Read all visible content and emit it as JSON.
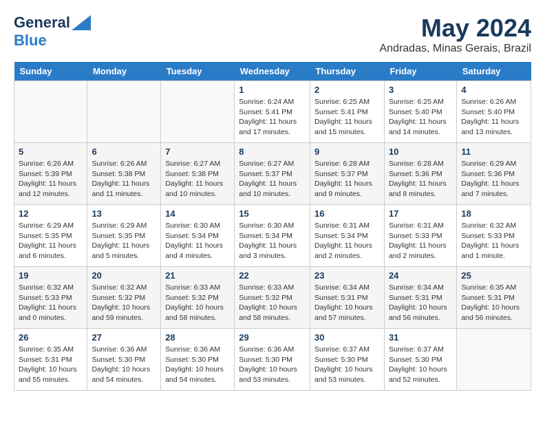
{
  "logo": {
    "line1": "General",
    "line2": "Blue"
  },
  "title": "May 2024",
  "subtitle": "Andradas, Minas Gerais, Brazil",
  "days_of_week": [
    "Sunday",
    "Monday",
    "Tuesday",
    "Wednesday",
    "Thursday",
    "Friday",
    "Saturday"
  ],
  "weeks": [
    [
      {
        "day": "",
        "info": ""
      },
      {
        "day": "",
        "info": ""
      },
      {
        "day": "",
        "info": ""
      },
      {
        "day": "1",
        "info": "Sunrise: 6:24 AM\nSunset: 5:41 PM\nDaylight: 11 hours and 17 minutes."
      },
      {
        "day": "2",
        "info": "Sunrise: 6:25 AM\nSunset: 5:41 PM\nDaylight: 11 hours and 15 minutes."
      },
      {
        "day": "3",
        "info": "Sunrise: 6:25 AM\nSunset: 5:40 PM\nDaylight: 11 hours and 14 minutes."
      },
      {
        "day": "4",
        "info": "Sunrise: 6:26 AM\nSunset: 5:40 PM\nDaylight: 11 hours and 13 minutes."
      }
    ],
    [
      {
        "day": "5",
        "info": "Sunrise: 6:26 AM\nSunset: 5:39 PM\nDaylight: 11 hours and 12 minutes."
      },
      {
        "day": "6",
        "info": "Sunrise: 6:26 AM\nSunset: 5:38 PM\nDaylight: 11 hours and 11 minutes."
      },
      {
        "day": "7",
        "info": "Sunrise: 6:27 AM\nSunset: 5:38 PM\nDaylight: 11 hours and 10 minutes."
      },
      {
        "day": "8",
        "info": "Sunrise: 6:27 AM\nSunset: 5:37 PM\nDaylight: 11 hours and 10 minutes."
      },
      {
        "day": "9",
        "info": "Sunrise: 6:28 AM\nSunset: 5:37 PM\nDaylight: 11 hours and 9 minutes."
      },
      {
        "day": "10",
        "info": "Sunrise: 6:28 AM\nSunset: 5:36 PM\nDaylight: 11 hours and 8 minutes."
      },
      {
        "day": "11",
        "info": "Sunrise: 6:29 AM\nSunset: 5:36 PM\nDaylight: 11 hours and 7 minutes."
      }
    ],
    [
      {
        "day": "12",
        "info": "Sunrise: 6:29 AM\nSunset: 5:35 PM\nDaylight: 11 hours and 6 minutes."
      },
      {
        "day": "13",
        "info": "Sunrise: 6:29 AM\nSunset: 5:35 PM\nDaylight: 11 hours and 5 minutes."
      },
      {
        "day": "14",
        "info": "Sunrise: 6:30 AM\nSunset: 5:34 PM\nDaylight: 11 hours and 4 minutes."
      },
      {
        "day": "15",
        "info": "Sunrise: 6:30 AM\nSunset: 5:34 PM\nDaylight: 11 hours and 3 minutes."
      },
      {
        "day": "16",
        "info": "Sunrise: 6:31 AM\nSunset: 5:34 PM\nDaylight: 11 hours and 2 minutes."
      },
      {
        "day": "17",
        "info": "Sunrise: 6:31 AM\nSunset: 5:33 PM\nDaylight: 11 hours and 2 minutes."
      },
      {
        "day": "18",
        "info": "Sunrise: 6:32 AM\nSunset: 5:33 PM\nDaylight: 11 hours and 1 minute."
      }
    ],
    [
      {
        "day": "19",
        "info": "Sunrise: 6:32 AM\nSunset: 5:33 PM\nDaylight: 11 hours and 0 minutes."
      },
      {
        "day": "20",
        "info": "Sunrise: 6:32 AM\nSunset: 5:32 PM\nDaylight: 10 hours and 59 minutes."
      },
      {
        "day": "21",
        "info": "Sunrise: 6:33 AM\nSunset: 5:32 PM\nDaylight: 10 hours and 58 minutes."
      },
      {
        "day": "22",
        "info": "Sunrise: 6:33 AM\nSunset: 5:32 PM\nDaylight: 10 hours and 58 minutes."
      },
      {
        "day": "23",
        "info": "Sunrise: 6:34 AM\nSunset: 5:31 PM\nDaylight: 10 hours and 57 minutes."
      },
      {
        "day": "24",
        "info": "Sunrise: 6:34 AM\nSunset: 5:31 PM\nDaylight: 10 hours and 56 minutes."
      },
      {
        "day": "25",
        "info": "Sunrise: 6:35 AM\nSunset: 5:31 PM\nDaylight: 10 hours and 56 minutes."
      }
    ],
    [
      {
        "day": "26",
        "info": "Sunrise: 6:35 AM\nSunset: 5:31 PM\nDaylight: 10 hours and 55 minutes."
      },
      {
        "day": "27",
        "info": "Sunrise: 6:36 AM\nSunset: 5:30 PM\nDaylight: 10 hours and 54 minutes."
      },
      {
        "day": "28",
        "info": "Sunrise: 6:36 AM\nSunset: 5:30 PM\nDaylight: 10 hours and 54 minutes."
      },
      {
        "day": "29",
        "info": "Sunrise: 6:36 AM\nSunset: 5:30 PM\nDaylight: 10 hours and 53 minutes."
      },
      {
        "day": "30",
        "info": "Sunrise: 6:37 AM\nSunset: 5:30 PM\nDaylight: 10 hours and 53 minutes."
      },
      {
        "day": "31",
        "info": "Sunrise: 6:37 AM\nSunset: 5:30 PM\nDaylight: 10 hours and 52 minutes."
      },
      {
        "day": "",
        "info": ""
      }
    ]
  ]
}
